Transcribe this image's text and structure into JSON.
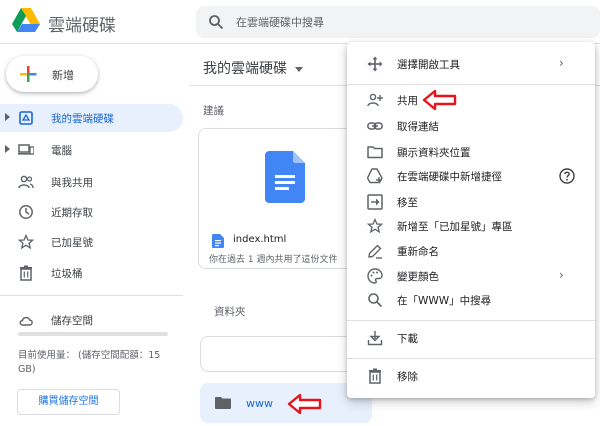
{
  "app": {
    "title": "雲端硬碟"
  },
  "search": {
    "placeholder": "在雲端硬碟中搜尋"
  },
  "sidebar": {
    "new_label": "新增",
    "items": [
      {
        "label": "我的雲端硬碟",
        "icon": "my-drive-icon",
        "active": true,
        "expandable": true
      },
      {
        "label": "電腦",
        "icon": "computers-icon",
        "active": false,
        "expandable": true
      },
      {
        "label": "與我共用",
        "icon": "shared-with-me-icon",
        "active": false
      },
      {
        "label": "近期存取",
        "icon": "recent-icon",
        "active": false
      },
      {
        "label": "已加星號",
        "icon": "star-icon",
        "active": false
      },
      {
        "label": "垃圾桶",
        "icon": "trash-icon",
        "active": false
      }
    ],
    "storage": {
      "label": "儲存空間",
      "usage_text": "目前使用量：          (儲存空間配額：15 GB)",
      "buy_label": "購買儲存空間"
    }
  },
  "main": {
    "title": "我的雲端硬碟",
    "suggested_label": "建議",
    "file": {
      "name": "index.html",
      "subtitle": "你在過去 1 週內共用了這份文件"
    },
    "folders_label": "資料夾",
    "folder": {
      "name": "www"
    }
  },
  "context_menu": {
    "items": [
      {
        "label": "選擇開啟工具",
        "icon": "open-with-icon",
        "submenu": true
      },
      {
        "label": "共用",
        "icon": "share-person-add-icon",
        "highlighted": true
      },
      {
        "label": "取得連結",
        "icon": "link-icon"
      },
      {
        "label": "顯示資料夾位置",
        "icon": "folder-outline-icon"
      },
      {
        "label": "在雲端硬碟中新增捷徑",
        "icon": "add-shortcut-icon",
        "help": true
      },
      {
        "label": "移至",
        "icon": "move-to-icon"
      },
      {
        "label": "新增至「已加星號」專區",
        "icon": "star-outline-icon"
      },
      {
        "label": "重新命名",
        "icon": "rename-pencil-icon"
      },
      {
        "label": "變更顏色",
        "icon": "palette-icon",
        "submenu": true
      },
      {
        "label": "在「WWW」中搜尋",
        "icon": "search-icon"
      },
      {
        "label": "下載",
        "icon": "download-icon"
      },
      {
        "label": "移除",
        "icon": "trash-icon"
      }
    ],
    "submenu_glyph": "›"
  },
  "colors": {
    "accent": "#1a73e8",
    "active_bg": "#e8f0fe",
    "annotation_arrow": "#e8141b"
  }
}
